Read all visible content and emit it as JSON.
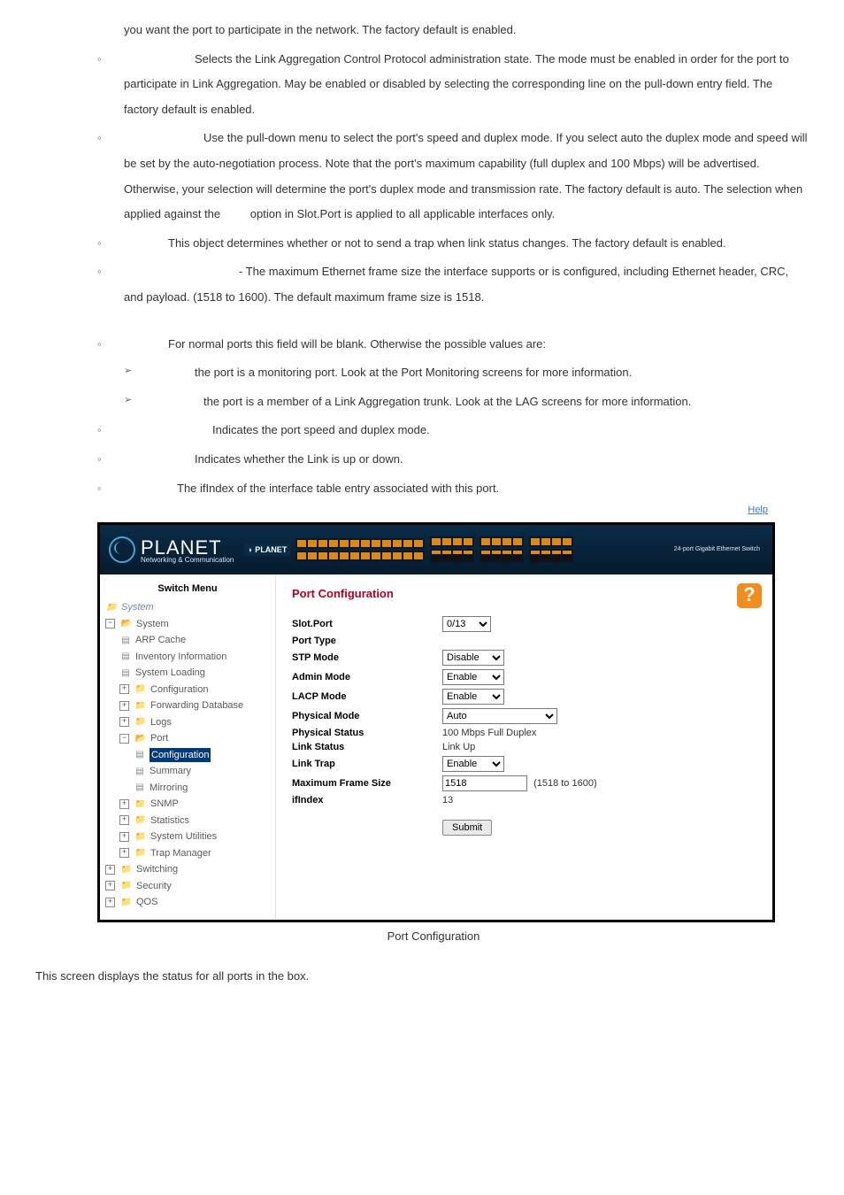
{
  "doc": {
    "p0": "you want the port to participate in the network. The factory default is enabled.",
    "p1": "Selects the Link Aggregation Control Protocol administration state. The mode must be enabled in order for the port to participate in Link Aggregation. May be enabled or disabled by selecting the corresponding line on the pull-down entry field. The factory default is enabled.",
    "p2_a": "Use the pull-down menu to select the port's speed and duplex mode. If you select auto the duplex mode and speed will be set by the auto-negotiation process. Note that the port's maximum capability (full duplex and 100 Mbps) will be advertised. Otherwise, your selection will determine the port's duplex mode and transmission rate. The factory default is auto. The selection when applied against the",
    "p2_b": "option in Slot.Port is applied to all applicable interfaces only.",
    "p3": "This object determines whether or not to send a trap when link status changes. The factory default is enabled.",
    "p4": "- The maximum Ethernet frame size the interface supports or is configured, including Ethernet header, CRC, and payload. (1518 to 1600). The default maximum frame size is 1518.",
    "p5": "For normal ports this field will be blank. Otherwise the possible values are:",
    "p6": "the port is a monitoring port. Look at the Port Monitoring screens for more information.",
    "p7": "the port is a member of a Link Aggregation trunk. Look at the LAG screens for more information.",
    "p8": "Indicates the port speed and duplex mode.",
    "p9": "Indicates whether the Link is up or down.",
    "p10": "The ifIndex of the interface table entry associated with this port."
  },
  "ui": {
    "help_link": "Help",
    "brand": "PLANET",
    "brand_sub": "Networking & Communication",
    "device_label": "24-port Gigabit Ethernet Switch",
    "sidebar_title": "Switch Menu",
    "panel_title": "Port Configuration",
    "submit": "Submit",
    "tree": {
      "root": "System",
      "system": "System",
      "arp": "ARP Cache",
      "inventory": "Inventory Information",
      "loading": "System Loading",
      "config": "Configuration",
      "fwd": "Forwarding Database",
      "logs": "Logs",
      "port": "Port",
      "port_config": "Configuration",
      "port_summary": "Summary",
      "port_mirror": "Mirroring",
      "snmp": "SNMP",
      "stats": "Statistics",
      "sysutil": "System Utilities",
      "trap": "Trap Manager",
      "switching": "Switching",
      "security": "Security",
      "qos": "QOS"
    },
    "form": {
      "slot_port": "Slot.Port",
      "slot_port_val": "0/13",
      "port_type": "Port Type",
      "stp_mode": "STP Mode",
      "stp_mode_val": "Disable",
      "admin_mode": "Admin Mode",
      "admin_mode_val": "Enable",
      "lacp_mode": "LACP Mode",
      "lacp_mode_val": "Enable",
      "phys_mode": "Physical Mode",
      "phys_mode_val": "Auto",
      "phys_status": "Physical Status",
      "phys_status_val": "100 Mbps Full Duplex",
      "link_status": "Link Status",
      "link_status_val": "Link Up",
      "link_trap": "Link Trap",
      "link_trap_val": "Enable",
      "max_frame": "Maximum Frame Size",
      "max_frame_val": "1518",
      "max_frame_range": "(1518 to 1600)",
      "ifindex": "ifIndex",
      "ifindex_val": "13"
    }
  },
  "caption": "Port Configuration",
  "footer": "This screen displays the status for all ports in the box."
}
